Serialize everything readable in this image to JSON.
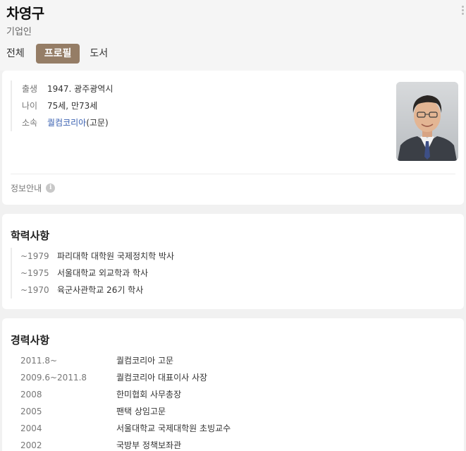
{
  "header": {
    "name": "차영구",
    "subtitle": "기업인",
    "tabs": [
      {
        "label": "전체",
        "active": false
      },
      {
        "label": "프로필",
        "active": true
      },
      {
        "label": "도서",
        "active": false
      }
    ]
  },
  "profile": {
    "rows": [
      {
        "label": "출생",
        "value": "1947. 광주광역시"
      },
      {
        "label": "나이",
        "value": "75세, 만73세"
      },
      {
        "label": "소속",
        "link": "퀄컴코리아",
        "suffix": "(고문)"
      }
    ],
    "info_guide": "정보안내"
  },
  "education": {
    "title": "학력사항",
    "items": [
      {
        "year": "~1979",
        "text": "파리대학 대학원 국제정치학 박사"
      },
      {
        "year": "~1975",
        "text": "서울대학교 외교학과 학사"
      },
      {
        "year": "~1970",
        "text": "육군사관학교 26기 학사"
      }
    ]
  },
  "career": {
    "title": "경력사항",
    "items": [
      {
        "year": "2011.8~",
        "text": "퀄컴코리아 고문"
      },
      {
        "year": "2009.6~2011.8",
        "text": "퀄컴코리아 대표이사 사장"
      },
      {
        "year": "2008",
        "text": "한미협회 사무총장"
      },
      {
        "year": "2005",
        "text": "팬택 상임고문"
      },
      {
        "year": "2004",
        "text": "서울대학교 국제대학원 초빙교수"
      },
      {
        "year": "2002",
        "text": "국방부 정책보좌관"
      }
    ]
  },
  "colors": {
    "active_tab": "#957d66",
    "link": "#3b62b2"
  }
}
